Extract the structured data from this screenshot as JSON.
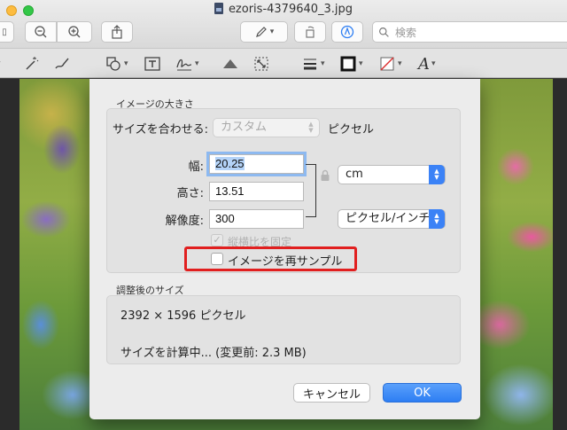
{
  "window": {
    "title": "ezoris-4379640_3.jpg",
    "search_placeholder": "検索"
  },
  "dialog": {
    "image_size_section": "イメージの大きさ",
    "fit_label": "サイズを合わせる:",
    "fit_value": "カスタム",
    "fit_unit": "ピクセル",
    "width_label": "幅:",
    "width_value": "20.25",
    "height_label": "高さ:",
    "height_value": "13.51",
    "resolution_label": "解像度:",
    "resolution_value": "300",
    "size_unit": "cm",
    "resolution_unit": "ピクセル/インチ",
    "scale_proportionally_label": "縦横比を固定",
    "scale_proportionally_checked": true,
    "resample_label": "イメージを再サンプル",
    "resample_checked": false,
    "resulting_size_section": "調整後のサイズ",
    "dimensions": "2392 × 1596 ピクセル",
    "file_size": "サイズを計算中... (変更前: 2.3 MB)",
    "cancel_label": "キャンセル",
    "ok_label": "OK"
  },
  "colors": {
    "accent": "#3b82f6",
    "highlight": "#e11f1f"
  }
}
